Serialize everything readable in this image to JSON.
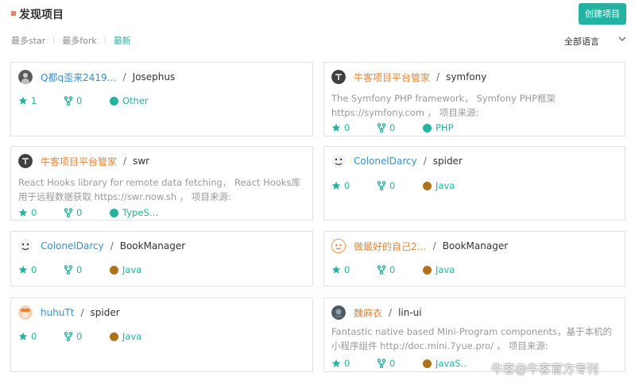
{
  "header": {
    "title": "发现项目",
    "create_label": "创建项目"
  },
  "sort_tabs": [
    "最多star",
    "最多fork",
    "最新"
  ],
  "language_filter": "全部语言",
  "colors": {
    "accent": "#26b2a0",
    "owner_link": "#3a8fc7",
    "owner_highlight": "#e5853b",
    "java": "#b07219",
    "php": "#26b2a0",
    "other": "#26b2a0"
  },
  "cards": [
    {
      "owner": "Q都q歪来2419…",
      "repo": "Josephus",
      "desc": "",
      "stars": "1",
      "forks": "0",
      "language": "Other"
    },
    {
      "owner": "牛客项目平台管家",
      "repo": "symfony",
      "desc": "The Symfony PHP framework， Symfony PHP框架 https://symfony.com ， 项目来源:",
      "stars": "0",
      "forks": "0",
      "language": "PHP"
    },
    {
      "owner": "牛客项目平台管家",
      "repo": "swr",
      "desc": "React Hooks library for remote data fetching， React Hooks库用于远程数据获取 https://swr.now.sh ， 项目来源:",
      "stars": "0",
      "forks": "0",
      "language": "TypeS…"
    },
    {
      "owner": "ColonelDarcy",
      "repo": "spider",
      "desc": "",
      "stars": "0",
      "forks": "0",
      "language": "Java"
    },
    {
      "owner": "ColonelDarcy",
      "repo": "BookManager",
      "desc": "",
      "stars": "0",
      "forks": "0",
      "language": "Java"
    },
    {
      "owner": "做最好的自己2…",
      "repo": "BookManager",
      "desc": "",
      "stars": "0",
      "forks": "0",
      "language": "Java"
    },
    {
      "owner": "huhuTt",
      "repo": "spider",
      "desc": "",
      "stars": "0",
      "forks": "0",
      "language": "Java"
    },
    {
      "owner": "魏麻衣",
      "repo": "lin-ui",
      "desc": "Fantastic native based Mini-Program components，基于本机的小程序组件 http://doc.mini.7yue.pro/ ， 项目来源:",
      "stars": "0",
      "forks": "0",
      "language": "JavaS…"
    }
  ],
  "watermark": "牛客@牛客官方专刊"
}
